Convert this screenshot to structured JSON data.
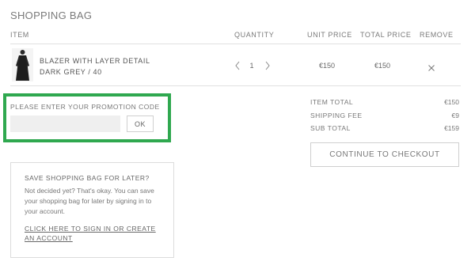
{
  "page": {
    "title": "SHOPPING BAG"
  },
  "table": {
    "headers": {
      "item": "ITEM",
      "quantity": "QUANTITY",
      "unit_price": "UNIT PRICE",
      "total_price": "TOTAL PRICE",
      "remove": "REMOVE"
    },
    "rows": [
      {
        "name": "BLAZER WITH LAYER DETAIL",
        "variant": "DARK GREY / 40",
        "quantity": "1",
        "unit_price": "€150",
        "total_price": "€150",
        "thumbnail_icon": "model-thumbnail",
        "prev_icon": "chevron-left-icon",
        "next_icon": "chevron-right-icon",
        "remove_icon": "close-icon"
      }
    ]
  },
  "promo": {
    "label": "PLEASE ENTER YOUR PROMOTION CODE",
    "value": "",
    "placeholder": "",
    "button": "OK",
    "highlight_color": "#2fa84f"
  },
  "summary": {
    "rows": [
      {
        "label": "ITEM TOTAL",
        "value": "€150"
      },
      {
        "label": "SHIPPING FEE",
        "value": "€9"
      },
      {
        "label": "SUB TOTAL",
        "value": "€159"
      }
    ],
    "checkout_button": "CONTINUE TO CHECKOUT"
  },
  "save_bag": {
    "title": "SAVE SHOPPING BAG FOR LATER?",
    "text": "Not decided yet? That's okay. You can save your shopping bag for later by signing in to your account.",
    "link": "CLICK HERE TO SIGN IN OR CREATE AN ACCOUNT"
  }
}
